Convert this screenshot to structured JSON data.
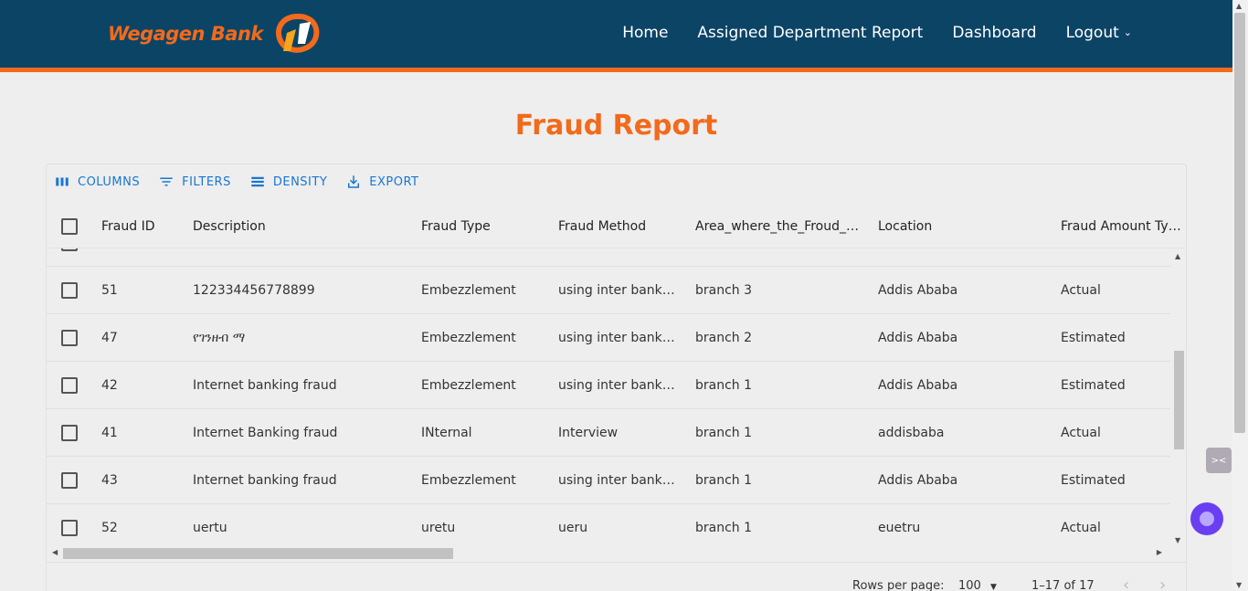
{
  "brand": {
    "name": "Wegagen Bank",
    "accent": "#f26a1b",
    "nav_bg": "#0c4466"
  },
  "nav": {
    "home": "Home",
    "assigned": "Assigned Department Report",
    "dashboard": "Dashboard",
    "logout": "Logout"
  },
  "page": {
    "title": "Fraud Report"
  },
  "toolbar": {
    "columns": "COLUMNS",
    "filters": "FILTERS",
    "density": "DENSITY",
    "export": "EXPORT"
  },
  "table": {
    "headers": [
      "Fraud ID",
      "Description",
      "Fraud Type",
      "Fraud Method",
      "Area_where_the_Froud_Commited",
      "Location",
      "Fraud Amount Type"
    ],
    "rows": [
      [
        "51",
        "122334456778899",
        "Embezzlement",
        "using inter banking",
        "branch 3",
        "Addis Ababa",
        "Actual"
      ],
      [
        "47",
        "የገንዘብ ማ",
        "Embezzlement",
        "using inter banking",
        "branch 2",
        "Addis Ababa",
        "Estimated"
      ],
      [
        "42",
        "Internet banking fraud",
        "Embezzlement",
        "using inter banking",
        "branch 1",
        "Addis Ababa",
        "Estimated"
      ],
      [
        "41",
        "Internet Banking fraud",
        "INternal",
        "Interview",
        "branch 1",
        "addisbaba",
        "Actual"
      ],
      [
        "43",
        "Internet banking fraud",
        "Embezzlement",
        "using inter banking",
        "branch 1",
        "Addis Ababa",
        "Estimated"
      ],
      [
        "52",
        "uertu",
        "uretu",
        "ueru",
        "branch 1",
        "euetru",
        "Actual"
      ]
    ]
  },
  "footer": {
    "rows_per_page_label": "Rows per page:",
    "rows_per_page": "100",
    "range": "1–17 of 17"
  }
}
